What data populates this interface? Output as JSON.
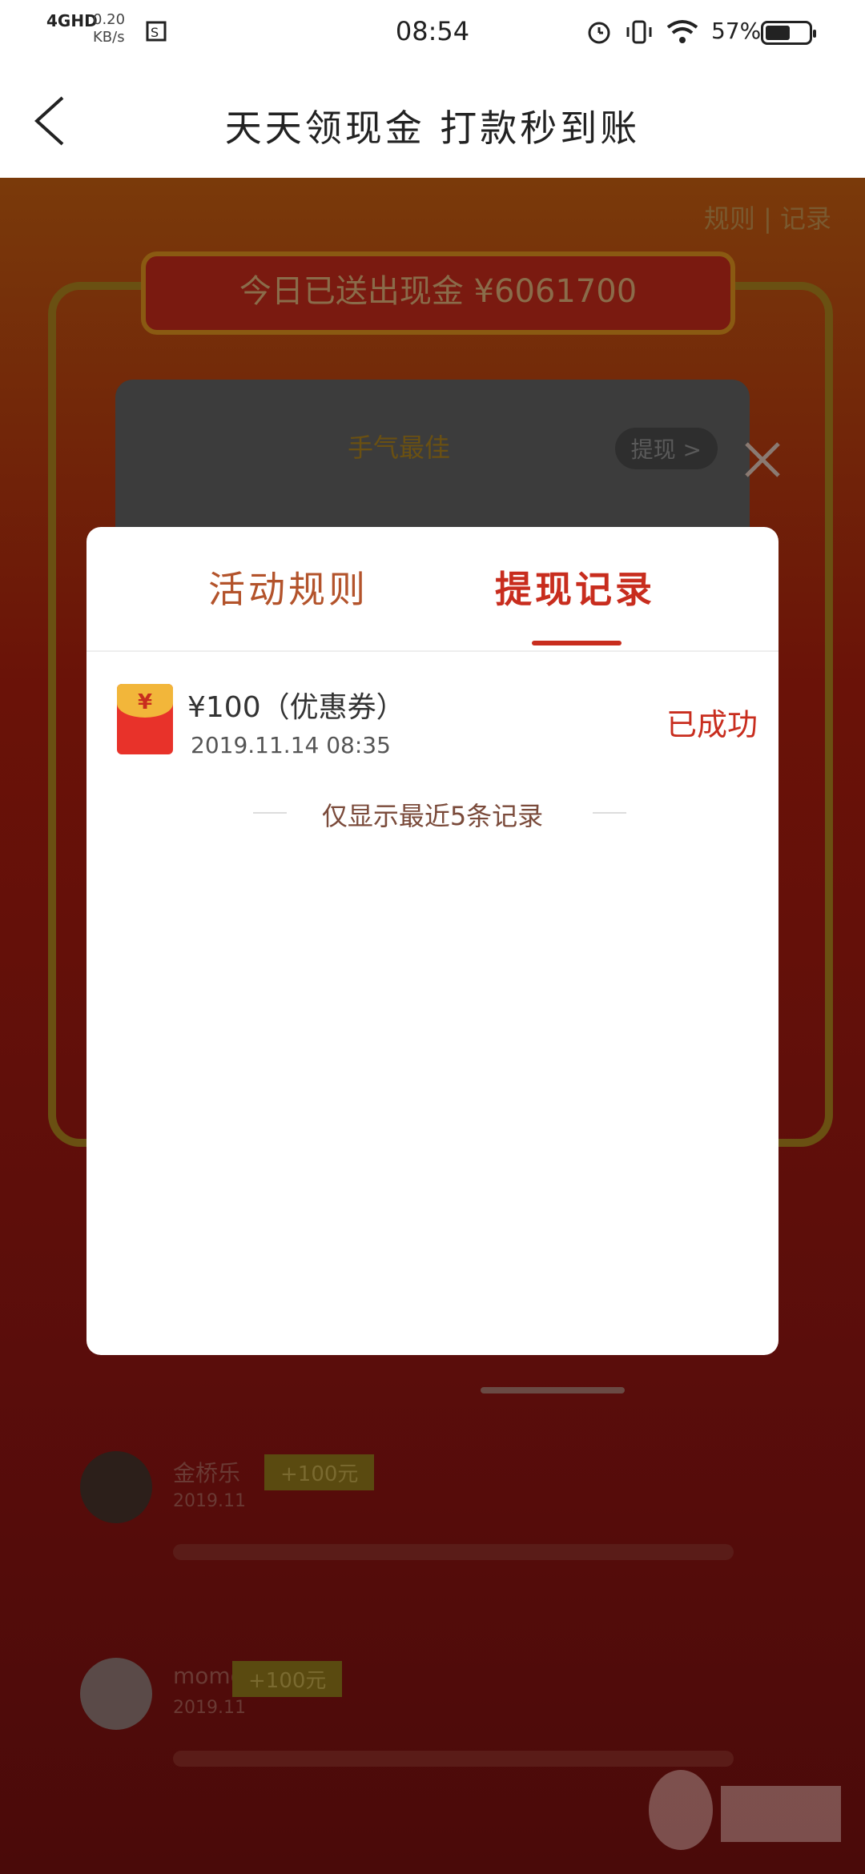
{
  "status_bar": {
    "network": "4GHD",
    "speed_value": "0.20",
    "speed_unit": "KB/s",
    "time": "08:54",
    "battery_percent": "57%",
    "battery_level": 0.57
  },
  "header": {
    "title": "天天领现金 打款秒到账"
  },
  "background": {
    "links": "规则 | 记录",
    "banner": "今日已送出现金 ¥6061700",
    "crown_text": "手气最佳",
    "withdraw_btn": "提现 >",
    "feed": [
      {
        "name": "金桥乐",
        "tag": "+100元",
        "date": "2019.11"
      },
      {
        "name": "momo",
        "tag": "+100元",
        "date": "2019.11"
      }
    ]
  },
  "modal": {
    "tabs": [
      {
        "label": "活动规则",
        "active": false
      },
      {
        "label": "提现记录",
        "active": true
      }
    ],
    "records": [
      {
        "amount": "¥100（优惠券）",
        "time": "2019.11.14 08:35",
        "status": "已成功"
      }
    ],
    "note": "仅显示最近5条记录"
  },
  "colors": {
    "accent": "#c82d1e",
    "tab_inactive": "#b3532b",
    "envelope_red": "#e8322a",
    "envelope_gold": "#f2b63a"
  }
}
